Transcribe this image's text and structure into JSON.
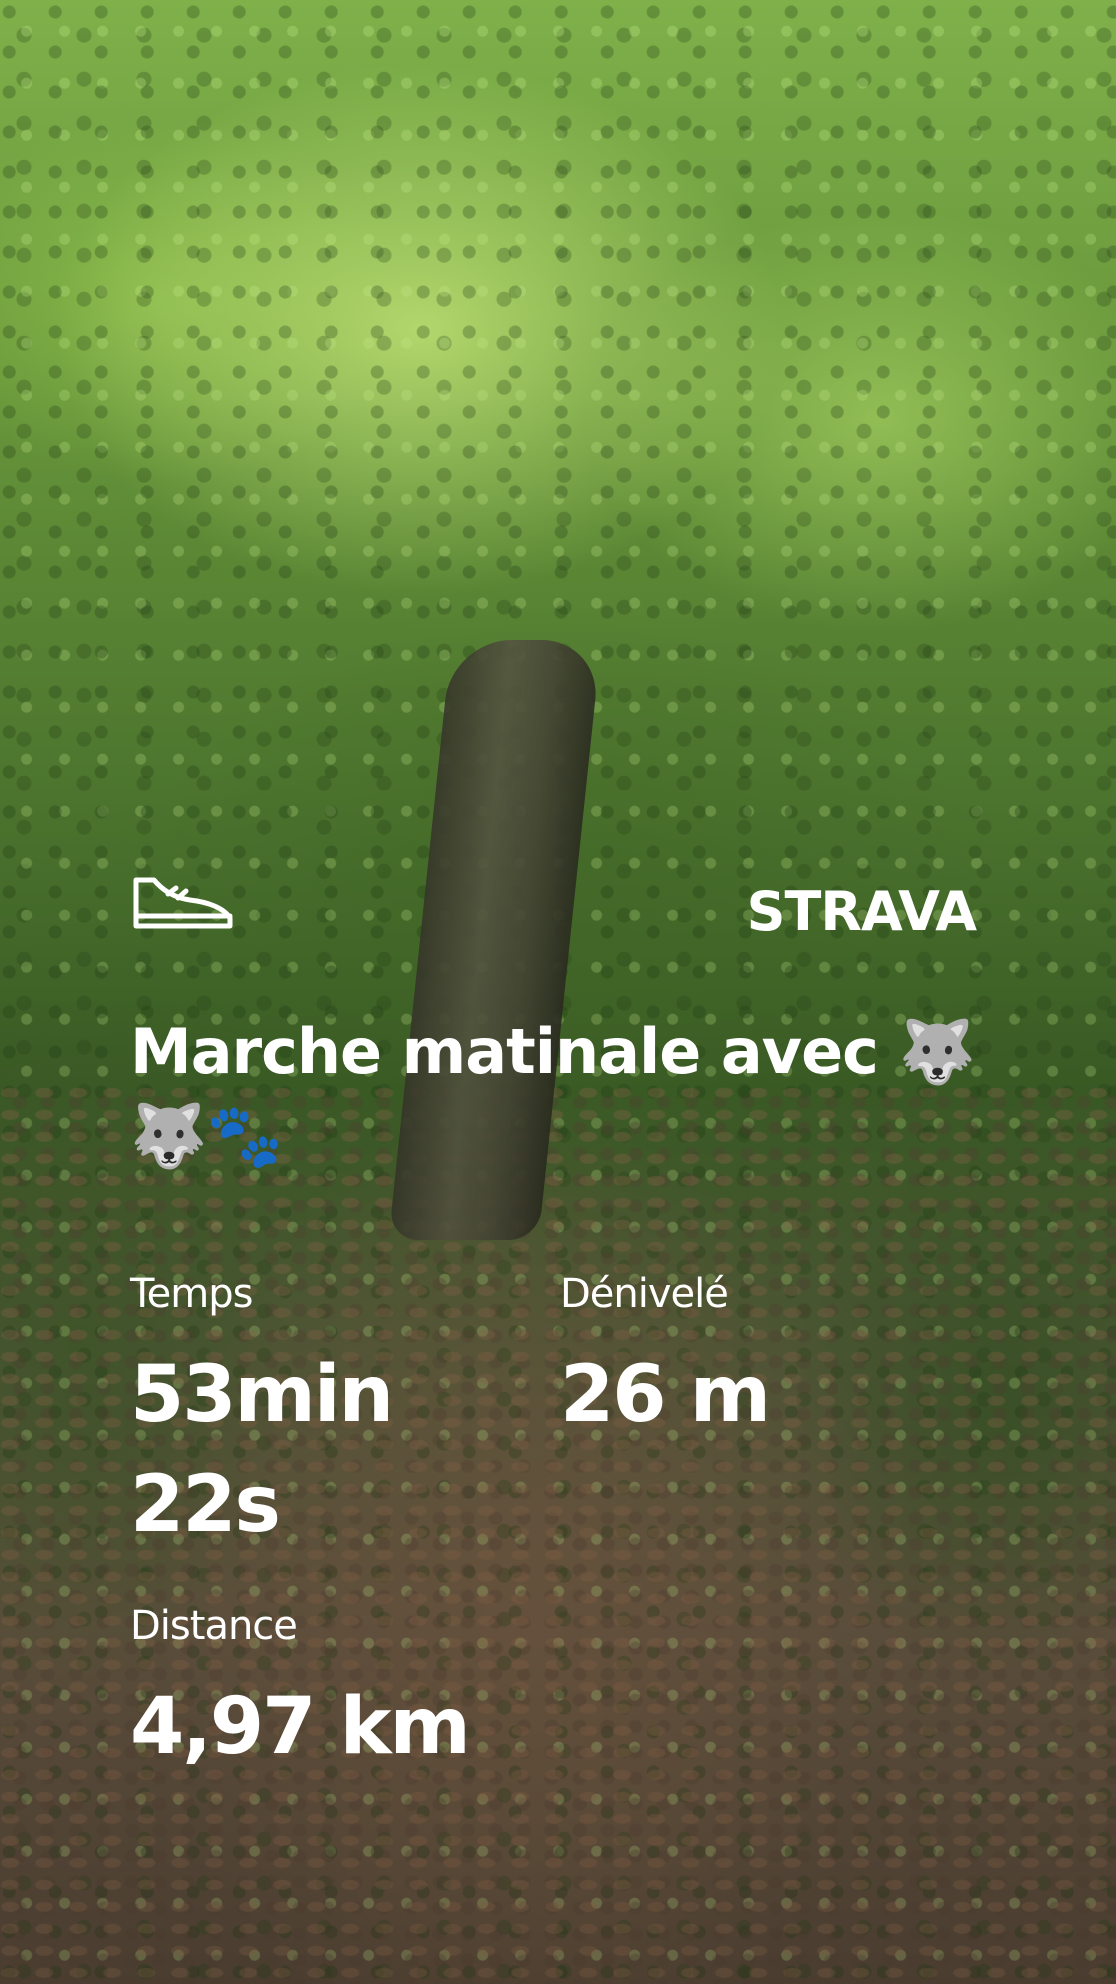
{
  "activity": {
    "icon": "shoe-icon",
    "title": "Marche matinale avec 🐺🐺🐾"
  },
  "brand": {
    "name": "STRAVA"
  },
  "stats": {
    "time": {
      "label": "Temps",
      "value": "53min 22s"
    },
    "elevation": {
      "label": "Dénivelé",
      "value": "26 m"
    },
    "distance": {
      "label": "Distance",
      "value": "4,97 km"
    }
  },
  "colors": {
    "text": "#ffffff"
  }
}
